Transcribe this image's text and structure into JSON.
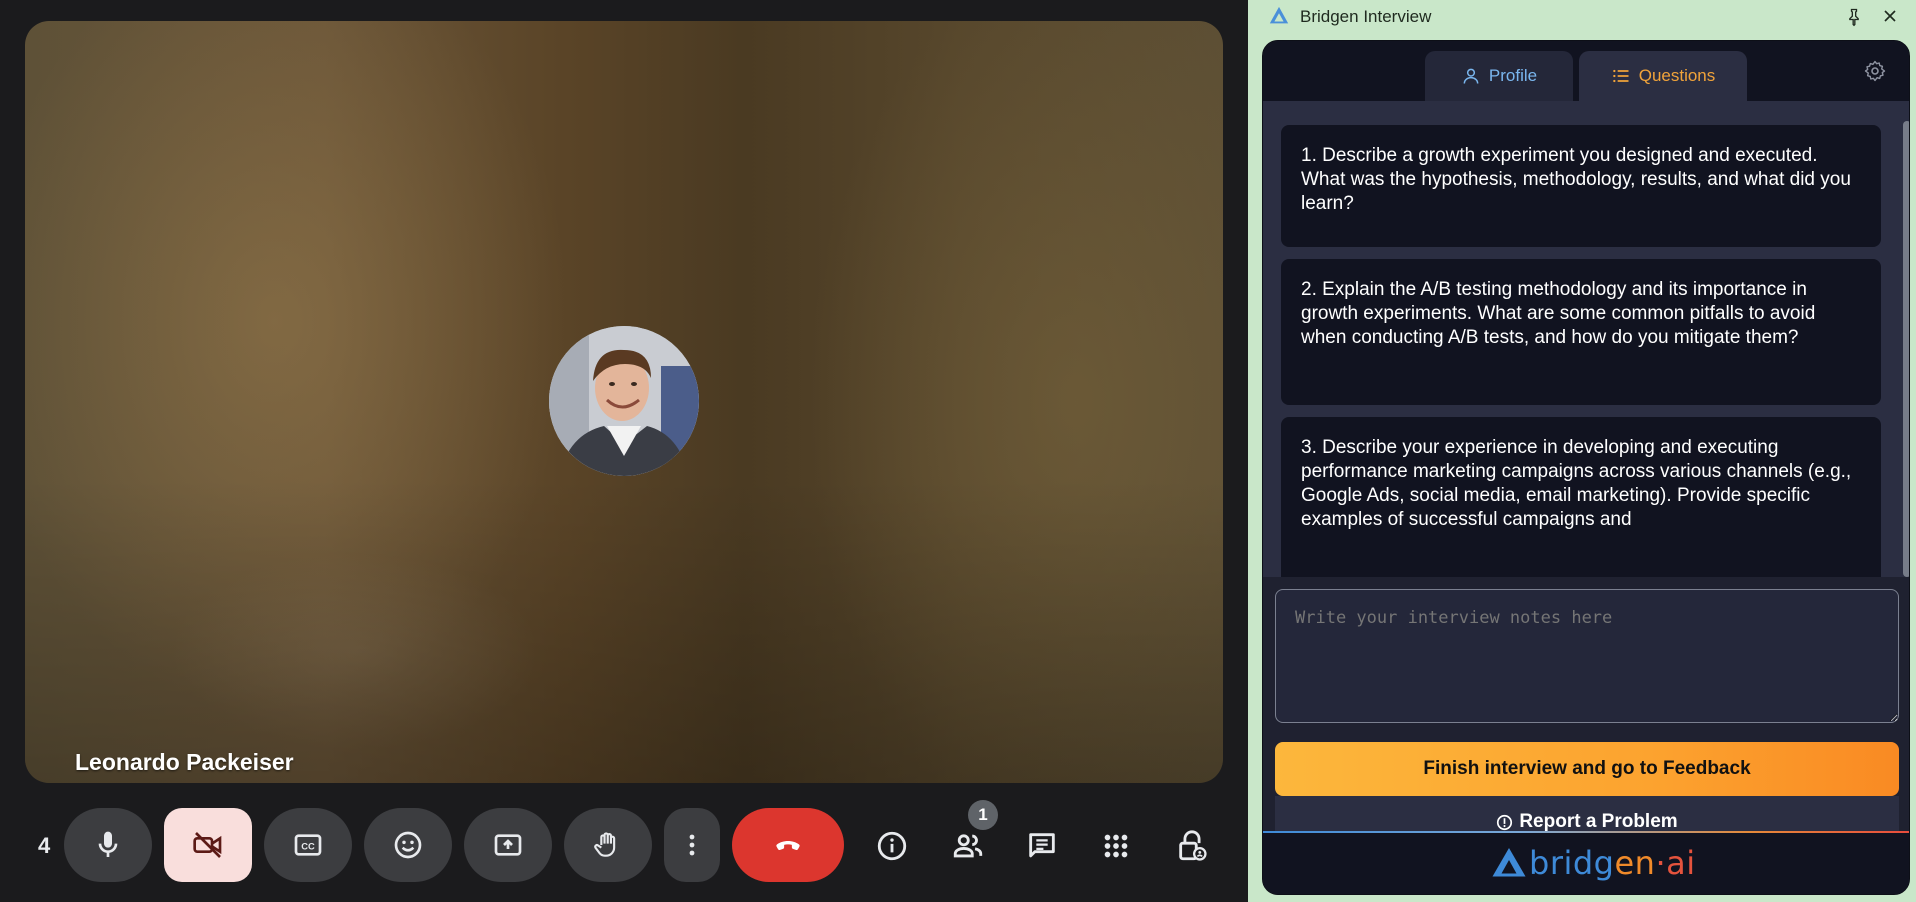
{
  "meet": {
    "participant_name": "Leonardo Packeiser",
    "time_display": "4",
    "participants_count": "1",
    "controls": [
      {
        "name": "microphone",
        "icon": "microphone-icon"
      },
      {
        "name": "camera",
        "icon": "camera-off-icon",
        "state": "off"
      },
      {
        "name": "captions",
        "icon": "closed-captions-icon"
      },
      {
        "name": "reactions",
        "icon": "emoji-icon"
      },
      {
        "name": "present",
        "icon": "present-screen-icon"
      },
      {
        "name": "raise-hand",
        "icon": "hand-icon"
      },
      {
        "name": "more-options",
        "icon": "more-vert-icon"
      },
      {
        "name": "leave-call",
        "icon": "call-end-icon"
      },
      {
        "name": "meeting-info",
        "icon": "info-icon"
      },
      {
        "name": "people",
        "icon": "people-icon"
      },
      {
        "name": "chat",
        "icon": "chat-icon"
      },
      {
        "name": "activities",
        "icon": "apps-grid-icon"
      },
      {
        "name": "host-controls",
        "icon": "lock-person-icon"
      }
    ],
    "colors": {
      "end_call": "#dc362e",
      "camera_off_bg": "#f9dedc"
    }
  },
  "bridgen": {
    "window_title": "Bridgen Interview",
    "tabs": [
      {
        "label": "Profile",
        "icon": "user-icon",
        "active": false
      },
      {
        "label": "Questions",
        "icon": "list-icon",
        "active": true
      }
    ],
    "questions": [
      "1. Describe a growth experiment you designed and executed. What was the hypothesis, methodology, results, and what did you learn?",
      "2. Explain the A/B testing methodology and its importance in growth experiments. What are some common pitfalls to avoid when conducting A/B tests, and how do you mitigate them?",
      "3. Describe your experience in developing and executing performance marketing campaigns across various channels (e.g., Google Ads, social media, email marketing). Provide specific examples of successful campaigns and"
    ],
    "notes": {
      "placeholder": "Write your interview notes here",
      "value": ""
    },
    "finish_button": "Finish interview and go to Feedback",
    "report_button": "Report a Problem",
    "brand": {
      "part1": "bridg",
      "part2": "en",
      "part3": "·ai"
    },
    "colors": {
      "accent_orange": "#fca32f",
      "accent_blue": "#3e8ad8"
    }
  }
}
